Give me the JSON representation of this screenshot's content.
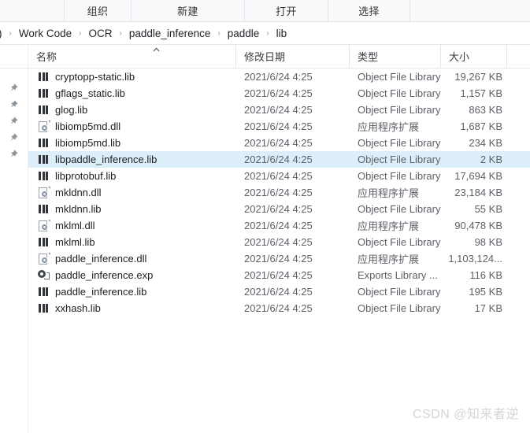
{
  "toolbar": {
    "items": [
      {
        "label": "组织",
        "name": "organize"
      },
      {
        "label": "新建",
        "name": "new"
      },
      {
        "label": "打开",
        "name": "open"
      },
      {
        "label": "选择",
        "name": "select"
      }
    ]
  },
  "breadcrumb": {
    "clipped_prefix": ")",
    "separator": "›",
    "segments": [
      "Work Code",
      "OCR",
      "paddle_inference",
      "paddle",
      "lib"
    ]
  },
  "columns": {
    "name": "名称",
    "date_modified": "修改日期",
    "type": "类型",
    "size": "大小",
    "sort_indicator": "^",
    "sort_column": "名称",
    "sort_direction": "ascending"
  },
  "gutter": {
    "pin_icon": "pin-icon",
    "pin_count": 5
  },
  "files": [
    {
      "name": "cryptopp-static.lib",
      "icon": "lib-icon",
      "date": "2021/6/24 4:25",
      "type": "Object File Library",
      "size": "19,267 KB",
      "selected": false
    },
    {
      "name": "gflags_static.lib",
      "icon": "lib-icon",
      "date": "2021/6/24 4:25",
      "type": "Object File Library",
      "size": "1,157 KB",
      "selected": false
    },
    {
      "name": "glog.lib",
      "icon": "lib-icon",
      "date": "2021/6/24 4:25",
      "type": "Object File Library",
      "size": "863 KB",
      "selected": false
    },
    {
      "name": "libiomp5md.dll",
      "icon": "dll-icon",
      "date": "2021/6/24 4:25",
      "type": "应用程序扩展",
      "size": "1,687 KB",
      "selected": false
    },
    {
      "name": "libiomp5md.lib",
      "icon": "lib-icon",
      "date": "2021/6/24 4:25",
      "type": "Object File Library",
      "size": "234 KB",
      "selected": false
    },
    {
      "name": "libpaddle_inference.lib",
      "icon": "lib-icon",
      "date": "2021/6/24 4:25",
      "type": "Object File Library",
      "size": "2 KB",
      "selected": true
    },
    {
      "name": "libprotobuf.lib",
      "icon": "lib-icon",
      "date": "2021/6/24 4:25",
      "type": "Object File Library",
      "size": "17,694 KB",
      "selected": false
    },
    {
      "name": "mkldnn.dll",
      "icon": "dll-icon",
      "date": "2021/6/24 4:25",
      "type": "应用程序扩展",
      "size": "23,184 KB",
      "selected": false
    },
    {
      "name": "mkldnn.lib",
      "icon": "lib-icon",
      "date": "2021/6/24 4:25",
      "type": "Object File Library",
      "size": "55 KB",
      "selected": false
    },
    {
      "name": "mklml.dll",
      "icon": "dll-icon",
      "date": "2021/6/24 4:25",
      "type": "应用程序扩展",
      "size": "90,478 KB",
      "selected": false
    },
    {
      "name": "mklml.lib",
      "icon": "lib-icon",
      "date": "2021/6/24 4:25",
      "type": "Object File Library",
      "size": "98 KB",
      "selected": false
    },
    {
      "name": "paddle_inference.dll",
      "icon": "dll-icon",
      "date": "2021/6/24 4:25",
      "type": "应用程序扩展",
      "size": "1,103,124...",
      "selected": false
    },
    {
      "name": "paddle_inference.exp",
      "icon": "exp-icon",
      "date": "2021/6/24 4:25",
      "type": "Exports Library ...",
      "size": "116 KB",
      "selected": false
    },
    {
      "name": "paddle_inference.lib",
      "icon": "lib-icon",
      "date": "2021/6/24 4:25",
      "type": "Object File Library",
      "size": "195 KB",
      "selected": false
    },
    {
      "name": "xxhash.lib",
      "icon": "lib-icon",
      "date": "2021/6/24 4:25",
      "type": "Object File Library",
      "size": "17 KB",
      "selected": false
    }
  ],
  "watermark": {
    "text": "CSDN @知来者逆"
  },
  "colors": {
    "selection": "#ddeefb",
    "toolbar_bg": "#f8f9fa",
    "text_primary": "#1c1d20",
    "text_secondary": "#5d6168",
    "border": "#e4e6e9"
  }
}
